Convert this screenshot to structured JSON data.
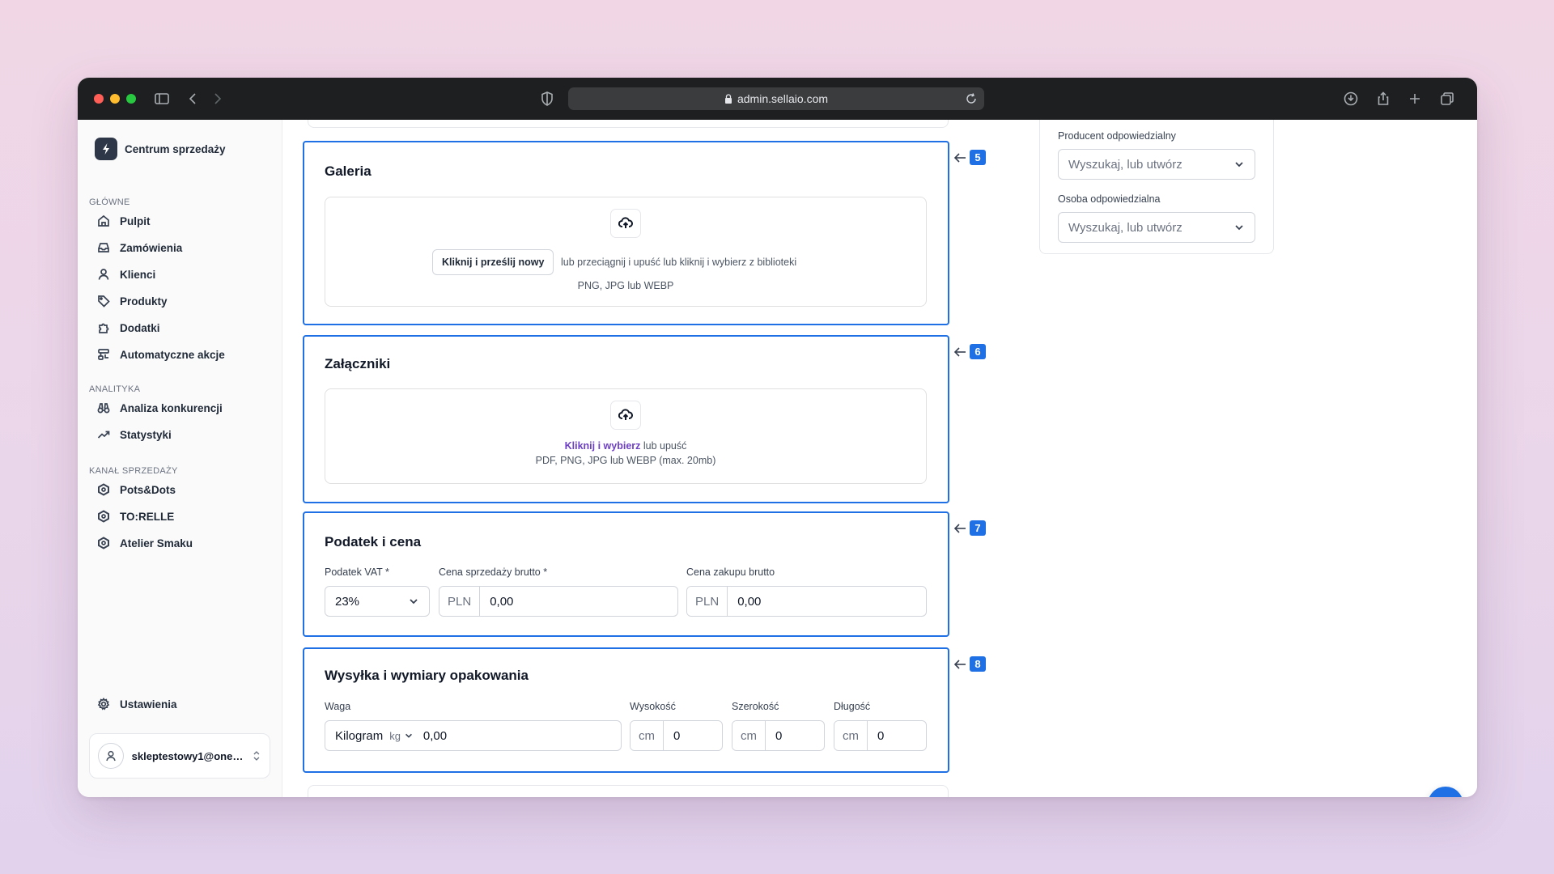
{
  "browser": {
    "url": "admin.sellaio.com"
  },
  "sidebar": {
    "brand": "Centrum sprzedaży",
    "sections": [
      {
        "title": "GŁÓWNE",
        "items": [
          "Pulpit",
          "Zamówienia",
          "Klienci",
          "Produkty",
          "Dodatki",
          "Automatyczne akcje"
        ]
      },
      {
        "title": "ANALITYKA",
        "items": [
          "Analiza konkurencji",
          "Statystyki"
        ]
      },
      {
        "title": "KANAŁ SPRZEDAŻY",
        "items": [
          "Pots&Dots",
          "TO:RELLE",
          "Atelier Smaku"
        ]
      }
    ],
    "settings": "Ustawienia",
    "user_email": "skleptestowy1@onet..."
  },
  "right_panel": {
    "producer_label": "Producent odpowiedzialny",
    "producer_placeholder": "Wyszukaj, lub utwórz",
    "person_label": "Osoba odpowiedzialna",
    "person_placeholder": "Wyszukaj, lub utwórz"
  },
  "gallery": {
    "badge": "5",
    "title": "Galeria",
    "upload_button": "Kliknij i prześlij nowy",
    "hint": "lub przeciągnij i upuść lub kliknij i wybierz z biblioteki",
    "formats": "PNG, JPG lub WEBP"
  },
  "attachments": {
    "badge": "6",
    "title": "Załączniki",
    "link": "Kliknij i wybierz",
    "hint": "lub upuść",
    "formats": "PDF, PNG, JPG lub WEBP (max. 20mb)"
  },
  "tax": {
    "badge": "7",
    "title": "Podatek i cena",
    "vat_label": "Podatek VAT *",
    "vat_value": "23%",
    "sale_label": "Cena sprzedaży brutto *",
    "sale_currency": "PLN",
    "sale_value": "0,00",
    "purchase_label": "Cena zakupu brutto",
    "purchase_currency": "PLN",
    "purchase_value": "0,00"
  },
  "shipping": {
    "badge": "8",
    "title": "Wysyłka i wymiary opakowania",
    "weight_label": "Waga",
    "weight_unit": "Kilogram",
    "weight_unit_short": "kg",
    "weight_value": "0,00",
    "height_label": "Wysokość",
    "height_unit": "cm",
    "height_value": "0",
    "width_label": "Szerokość",
    "width_unit": "cm",
    "width_value": "0",
    "length_label": "Długość",
    "length_unit": "cm",
    "length_value": "0"
  },
  "colors": {
    "accent": "#1f6fe5",
    "link": "#6d3fc4",
    "titlebar": "#1d1f20"
  }
}
